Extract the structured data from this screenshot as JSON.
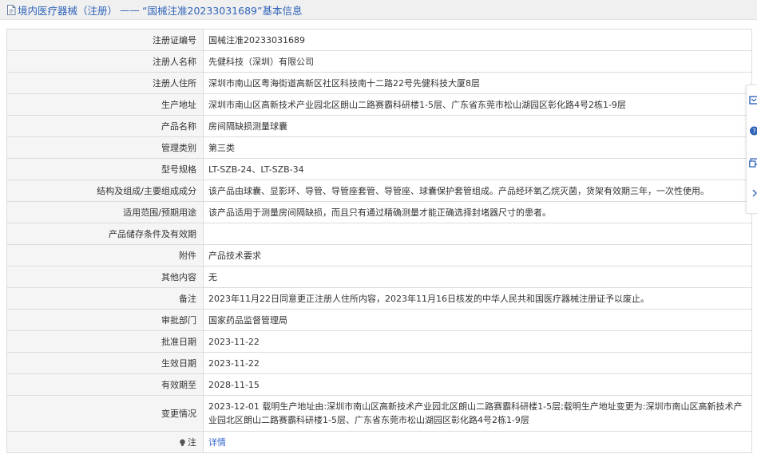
{
  "header": {
    "category": "境内医疗器械（注册）",
    "separator": "——",
    "title_quoted": "“国械注准20233031689”",
    "suffix": "基本信息"
  },
  "rows": [
    {
      "label": "注册证编号",
      "value": "国械注准20233031689"
    },
    {
      "label": "注册人名称",
      "value": "先健科技（深圳）有限公司"
    },
    {
      "label": "注册人住所",
      "value": "深圳市南山区粤海街道高新区社区科技南十二路22号先健科技大厦8层"
    },
    {
      "label": "生产地址",
      "value": "深圳市南山区高新技术产业园北区朗山二路赛霸科研楼1-5层、广东省东莞市松山湖园区彰化路4号2栋1-9层"
    },
    {
      "label": "产品名称",
      "value": "房间隔缺损测量球囊"
    },
    {
      "label": "管理类别",
      "value": "第三类"
    },
    {
      "label": "型号规格",
      "value": "LT-SZB-24、LT-SZB-34"
    },
    {
      "label": "结构及组成/主要组成成分",
      "value": "该产品由球囊、显影环、导管、导管座套管、导管座、球囊保护套管组成。产品经环氧乙烷灭菌，货架有效期三年，一次性使用。"
    },
    {
      "label": "适用范围/预期用途",
      "value": "该产品适用于测量房间隔缺损，而且只有通过精确测量才能正确选择封堵器尺寸的患者。"
    },
    {
      "label": "产品储存条件及有效期",
      "value": ""
    },
    {
      "label": "附件",
      "value": "产品技术要求"
    },
    {
      "label": "其他内容",
      "value": "无"
    },
    {
      "label": "备注",
      "value": "2023年11月22日同意更正注册人住所内容，2023年11月16日核发的中华人民共和国医疗器械注册证予以废止。"
    },
    {
      "label": "审批部门",
      "value": "国家药品监督管理局"
    },
    {
      "label": "批准日期",
      "value": "2023-11-22"
    },
    {
      "label": "生效日期",
      "value": "2023-11-22"
    },
    {
      "label": "有效期至",
      "value": "2028-11-15"
    },
    {
      "label": "变更情况",
      "value": "2023-12-01 载明生产地址由:深圳市南山区高新技术产业园北区朗山二路赛霸科研楼1-5层;载明生产地址变更为:深圳市南山区高新技术产业园北区朗山二路赛霸科研楼1-5层、广东省东莞市松山湖园区彰化路4号2栋1-9层"
    }
  ],
  "note_row": {
    "label": "注",
    "link_text": "详情"
  },
  "icons": {
    "header": "document-icon",
    "note": "bulb-icon",
    "side": [
      "feedback-icon",
      "help-icon",
      "share-icon",
      "chevron-right-icon"
    ]
  },
  "colors": {
    "title": "#2f63b8",
    "link": "#3366cc",
    "label_bg": "#f5f5f5",
    "border": "#dcdcdc"
  }
}
